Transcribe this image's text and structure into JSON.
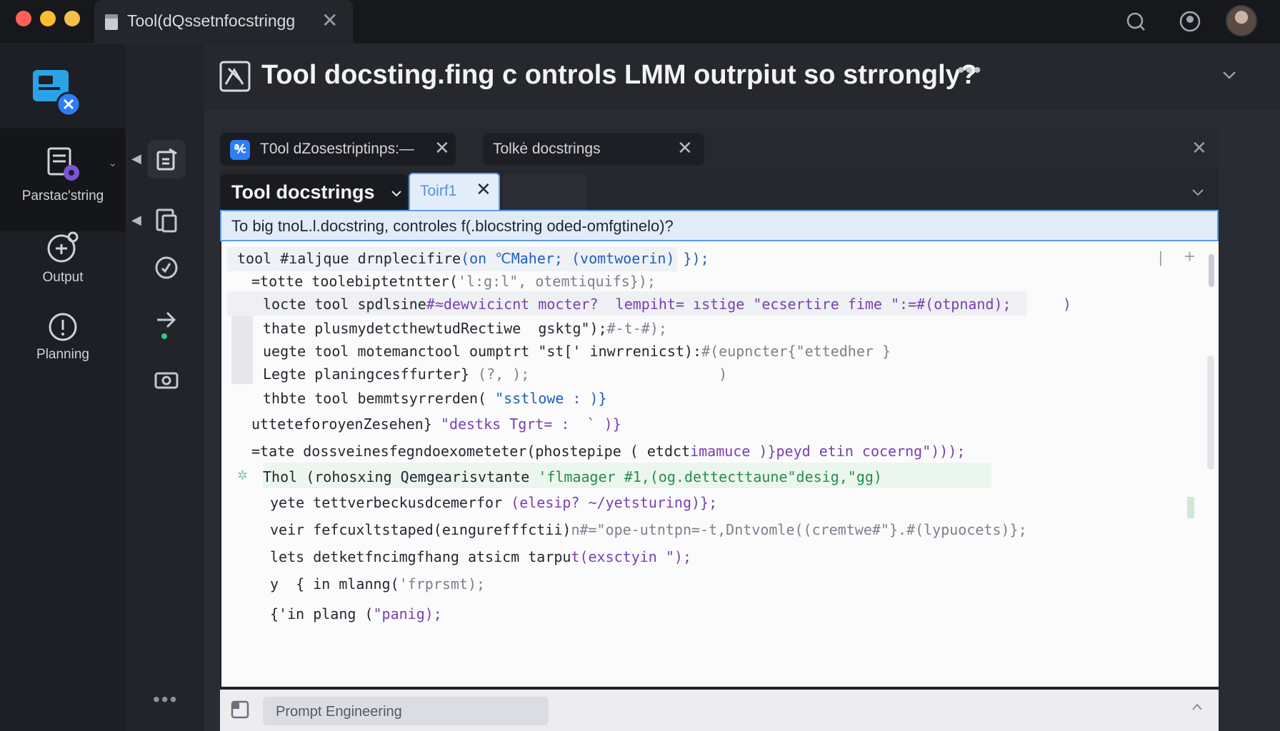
{
  "window": {
    "tab_label": "Tool(dQssetnfocstringg",
    "tab_close": "✕"
  },
  "sidebar": {
    "items": [
      {
        "label": "Parstac'string",
        "icon": "document-gear-icon"
      },
      {
        "label": "Output",
        "icon": "output-icon"
      },
      {
        "label": "Planning",
        "icon": "info-icon"
      }
    ]
  },
  "tools": {
    "more": "•••"
  },
  "header": {
    "title": "Tool docsting.fing c ontrols LMM  outrpiut so  strrongly?",
    "more": "•••"
  },
  "doc_tabs": [
    {
      "label": "T0ol dZosestriptinps:—",
      "badge": "℀",
      "close": "✕"
    },
    {
      "label": "Tolkė docstrings",
      "close": "✕"
    }
  ],
  "panel_close": "✕",
  "sub_tabs": {
    "main": "Tool docstrings",
    "alt": "Toirf1",
    "alt_close": "✕"
  },
  "query": "To big tnoL.l.docstring, controles f(.blocstring oded-omfgtinelo)?",
  "code_lines": [
    {
      "a": "tool #ıaljque drnplecifire",
      "b": "(on ℃Maher; (vomtwoerin) });"
    },
    {
      "a": "=totte toolebiptetntter(",
      "b": "'l:g:l\", otemtiquifs});"
    },
    {
      "a": "locte tool spdlsine",
      "b": "#≈dewvicicnt mocter?  lempiht= ıstige \"ecsertire fime \":=#(otpnand);      )"
    },
    {
      "a": "thate plusmydetcthewtudRectiwe  gsktg\");",
      "b": "#-t-#);"
    },
    {
      "a": "uegte tool motemanctool oumptrt \"st[' inwrrenicst):",
      "b": "#(eupncter{\"ettedher }"
    },
    {
      "a": "Legte planingcesffurter} ",
      "b": "(?, );                      )"
    },
    {
      "a": "thbte tool bemmtsyrrerden( ",
      "b": "\"sstlowe : )}"
    },
    {
      "a": "utteteforoyenZesehen} ",
      "b": "\"destks Tgrt= :  ` )}"
    },
    {
      "a": "=tate dossveinesfegndoexometeter(phostepipe ( etdct",
      "b": "imamuce )}peyd etin cocerng\")));"
    },
    {
      "a": "Thol (rohosxing Qemgearisvtante ",
      "b": "'flmaager #1,(og.dettecttaune\"desig,\"gg)"
    },
    {
      "a": "yete tettverbeckusdcemerfor ",
      "b": "(elesip? ~/yetsturing)};"
    },
    {
      "a": "veir fefcuxltstaped(eıngurefffctii)",
      "b": "n#=\"ope-utntpn=-t,Dntvomle((cremtwe#\"}.#(lypuocets)};"
    },
    {
      "a": "lets detketfncimgfhang atsicm tarpu",
      "b": "t(exsctyin \");"
    },
    {
      "a": "y  { in mlanng(",
      "b": "'frprsmt);"
    },
    {
      "a": "{'in plang (",
      "b": "\"panig);"
    }
  ],
  "code_side": {
    "plus": "+",
    "bar": "|"
  },
  "footer": {
    "field": "Prompt Engineering"
  },
  "colors": {
    "accent": "#2f7df6",
    "selection_border": "#5d9bea",
    "selection_bg": "#e2ecf8"
  }
}
